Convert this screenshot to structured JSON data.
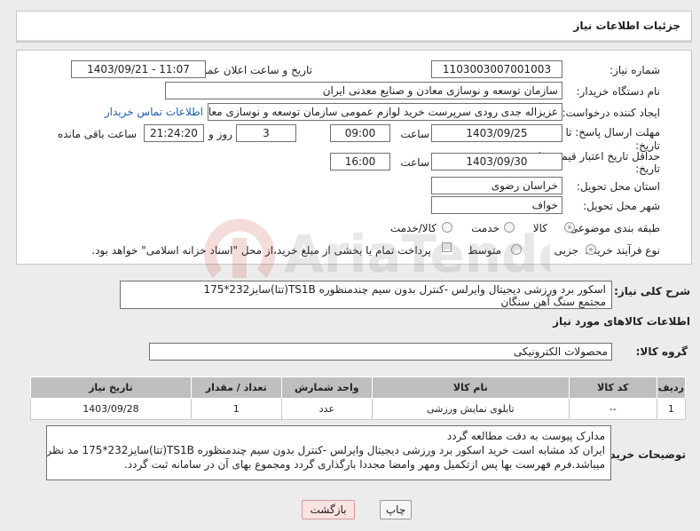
{
  "header": {
    "title": "جزئیات اطلاعات نیاز"
  },
  "fields": {
    "need_number_label": "شماره نیاز:",
    "need_number": "1103003007001003",
    "announce_label": "تاریخ و ساعت اعلان عمومی:",
    "announce_value": "1403/09/21 - 11:07",
    "buyer_org_label": "نام دستگاه خریدار:",
    "buyer_org": "سازمان توسعه و نوسازی معادن و صنایع معدنی ایران",
    "requester_label": "ایجاد کننده درخواست:",
    "requester": "عزیزاله جدی رودی سرپرست خرید لوازم عمومی  سازمان توسعه و نوسازی معادن",
    "contact_link": "اطلاعات تماس خریدار",
    "deadline_label_1": "مهلت ارسال پاسخ: تا",
    "deadline_label_2": "تاریخ:",
    "deadline_date": "1403/09/25",
    "time_label": "ساعت",
    "deadline_time": "09:00",
    "days_value": "3",
    "days_label": "روز و",
    "remaining_time": "21:24:20",
    "remaining_label": "ساعت باقی مانده",
    "validity_label_1": "حداقل تاریخ اعتبار قیمت: تا",
    "validity_label_2": "تاریخ:",
    "validity_date": "1403/09/30",
    "validity_time_label": "ساعت",
    "validity_time": "16:00",
    "province_label": "استان محل تحویل:",
    "province": "خراسان رضوی",
    "city_label": "شهر محل تحویل:",
    "city": "خواف",
    "category_label": "طبقه بندی موضوعی:",
    "category_options": [
      "کالا",
      "خدمت",
      "کالا/خدمت"
    ],
    "purchase_type_label": "نوع فرآیند خرید :",
    "purchase_options": [
      "جزیی",
      "متوسط"
    ],
    "payment_note": "پرداخت تمام یا بخشی از مبلغ خرید،از محل \"اسناد خزانه اسلامی\" خواهد بود."
  },
  "description": {
    "label": "شرح کلی نیاز:",
    "line1": "اسکور برد ورزشی دیجیتال وایرلس -کنترل بدون سیم چندمنظوره TS1B(تتا)سایز232*175",
    "line2": "مجتمع سنگ آهن سنگان"
  },
  "goods": {
    "section_title": "اطلاعات کالاهای مورد نیاز",
    "group_label": "گروه کالا:",
    "group_value": "محصولات الکترونیکی",
    "columns": [
      "ردیف",
      "کد کالا",
      "نام کالا",
      "واحد شمارش",
      "تعداد / مقدار",
      "تاریخ نیاز"
    ],
    "rows": [
      [
        "1",
        "--",
        "تابلوی نمایش ورزشی",
        "عدد",
        "1",
        "1403/09/28"
      ]
    ]
  },
  "buyer_notes": {
    "label": "توضیحات خریدار:",
    "line1": "مدارک پیوست به دقت مطالعه گردد",
    "line2": "ایران کد مشابه است خرید اسکور برد ورزشی دیجیتال وایرلس -کنترل بدون سیم چندمنظوره TS1B(تتا)سایز232*175 مد نظر",
    "line3": "میباشد.فرم فهرست بها پس ازتکمیل ومهر وامضا مجددا بارگذاری گردد ومجموع بهای آن در سامانه ثبت گردد."
  },
  "buttons": {
    "print": "چاپ",
    "back": "بازگشت"
  },
  "watermark_text": "AriaTender.neT",
  "colors": {
    "link": "#1a5fb4",
    "back_button": "#fbe3e3",
    "watermark": "#c0392b"
  }
}
